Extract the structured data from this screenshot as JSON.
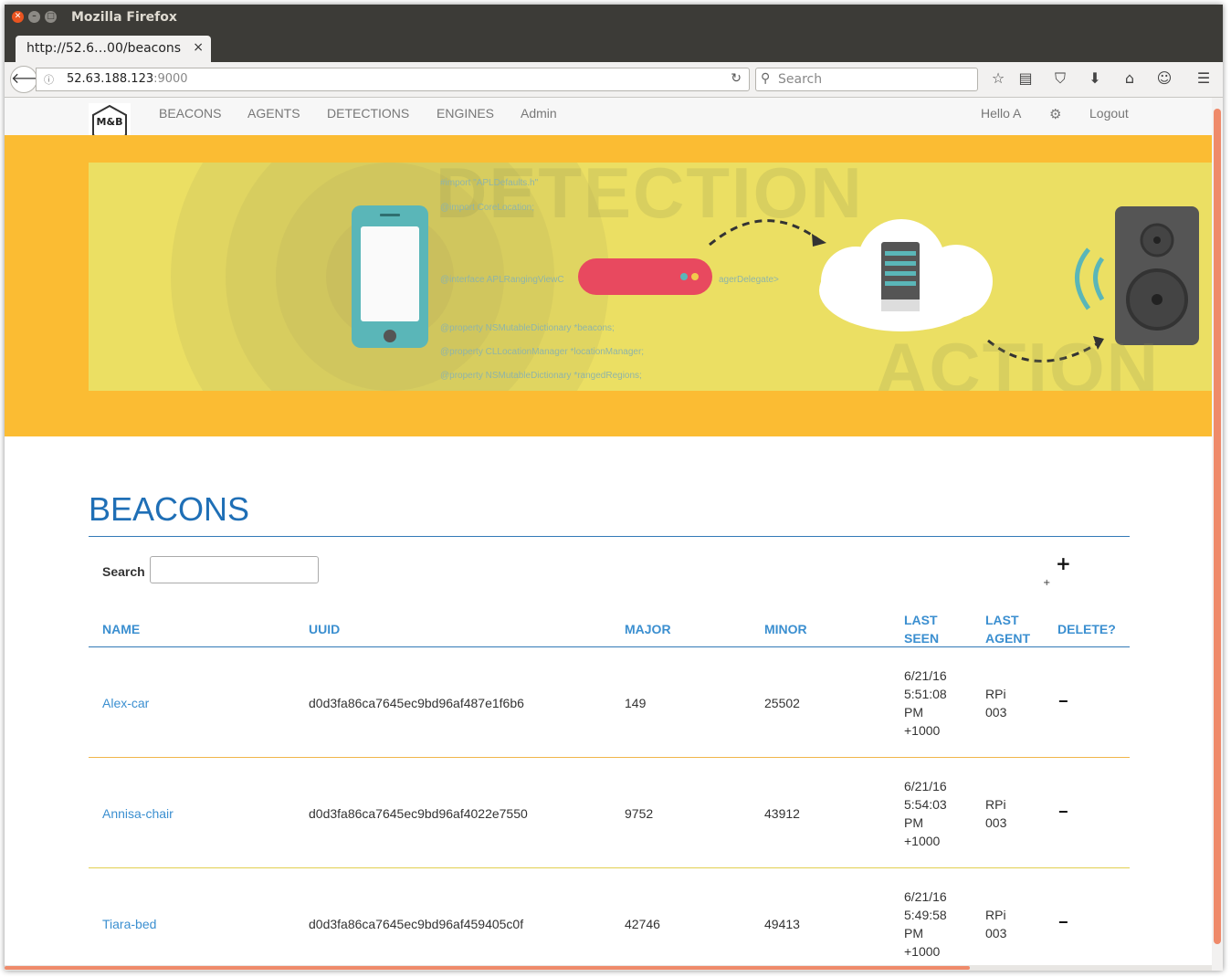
{
  "window": {
    "title": "Mozilla Firefox"
  },
  "tab": {
    "title": "http://52.6…00/beacons",
    "close": "×"
  },
  "urlbar": {
    "host": "52.63.188.123",
    "port": ":9000"
  },
  "browser_search": {
    "placeholder": "Search"
  },
  "toolbar_icons": [
    "bookmark-star-icon",
    "reader-list-icon",
    "pocket-icon",
    "download-icon",
    "home-icon",
    "hello-icon",
    "menu-icon"
  ],
  "logo": {
    "text": "M&B"
  },
  "nav": {
    "links": [
      "BEACONS",
      "AGENTS",
      "DETECTIONS",
      "ENGINES",
      "Admin"
    ],
    "greeting": "Hello A",
    "logout": "Logout"
  },
  "hero": {
    "word_top": "DETECTION",
    "word_bottom": "ACTION",
    "code": [
      "#import \"APLDefaults.h\"",
      "@import CoreLocation;",
      "@interface APLRangingViewC",
      "agerDelegate>",
      "@property NSMutableDictionary *beacons;",
      "@property CLLocationManager *locationManager;",
      "@property NSMutableDictionary *rangedRegions;"
    ]
  },
  "page": {
    "title": "BEACONS",
    "search_label": "Search",
    "add": "+",
    "add_small": "+"
  },
  "table": {
    "headers": {
      "name": "NAME",
      "uuid": "UUID",
      "major": "MAJOR",
      "minor": "MINOR",
      "last_seen_1": "LAST",
      "last_seen_2": "SEEN",
      "last_agent_1": "LAST",
      "last_agent_2": "AGENT",
      "delete": "DELETE?"
    },
    "rows": [
      {
        "name": "Alex-car",
        "uuid": "d0d3fa86ca7645ec9bd96af487e1f6b6",
        "major": "149",
        "minor": "25502",
        "seen": [
          "6/21/16",
          "5:51:08",
          "PM",
          "+1000"
        ],
        "agent": [
          "RPi",
          "003"
        ],
        "delete": "−"
      },
      {
        "name": "Annisa-chair",
        "uuid": "d0d3fa86ca7645ec9bd96af4022e7550",
        "major": "9752",
        "minor": "43912",
        "seen": [
          "6/21/16",
          "5:54:03",
          "PM",
          "+1000"
        ],
        "agent": [
          "RPi",
          "003"
        ],
        "delete": "−"
      },
      {
        "name": "Tiara-bed",
        "uuid": "d0d3fa86ca7645ec9bd96af459405c0f",
        "major": "42746",
        "minor": "49413",
        "seen": [
          "6/21/16",
          "5:49:58",
          "PM",
          "+1000"
        ],
        "agent": [
          "RPi",
          "003"
        ],
        "delete": "−"
      }
    ]
  },
  "colors": {
    "accent": "#1f6fb6",
    "link": "#3b8fd0",
    "hero_bg": "#fbbc33",
    "hero_panel": "#ebdf63",
    "scroll": "#ef8a6a"
  }
}
